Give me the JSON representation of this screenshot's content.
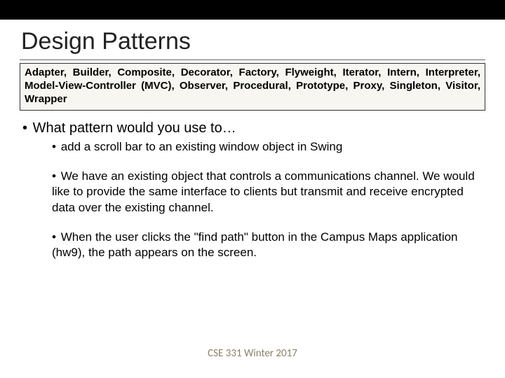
{
  "slide": {
    "title": "Design Patterns",
    "patterns_text": "Adapter, Builder, Composite, Decorator, Factory, Flyweight, Iterator, Intern, Interpreter, Model-View-Controller (MVC), Observer, Procedural, Prototype, Proxy, Singleton, Visitor, Wrapper",
    "question": "What pattern would you use to…",
    "items": [
      "add a scroll bar to an existing window object in Swing",
      "We have an existing object that controls a communications channel. We would like to provide the same interface to clients but transmit and receive encrypted data over the existing channel.",
      "When the user clicks the \"find path\" button in the Campus Maps application (hw9), the path appears on the screen."
    ],
    "footer": "CSE 331 Winter 2017"
  }
}
